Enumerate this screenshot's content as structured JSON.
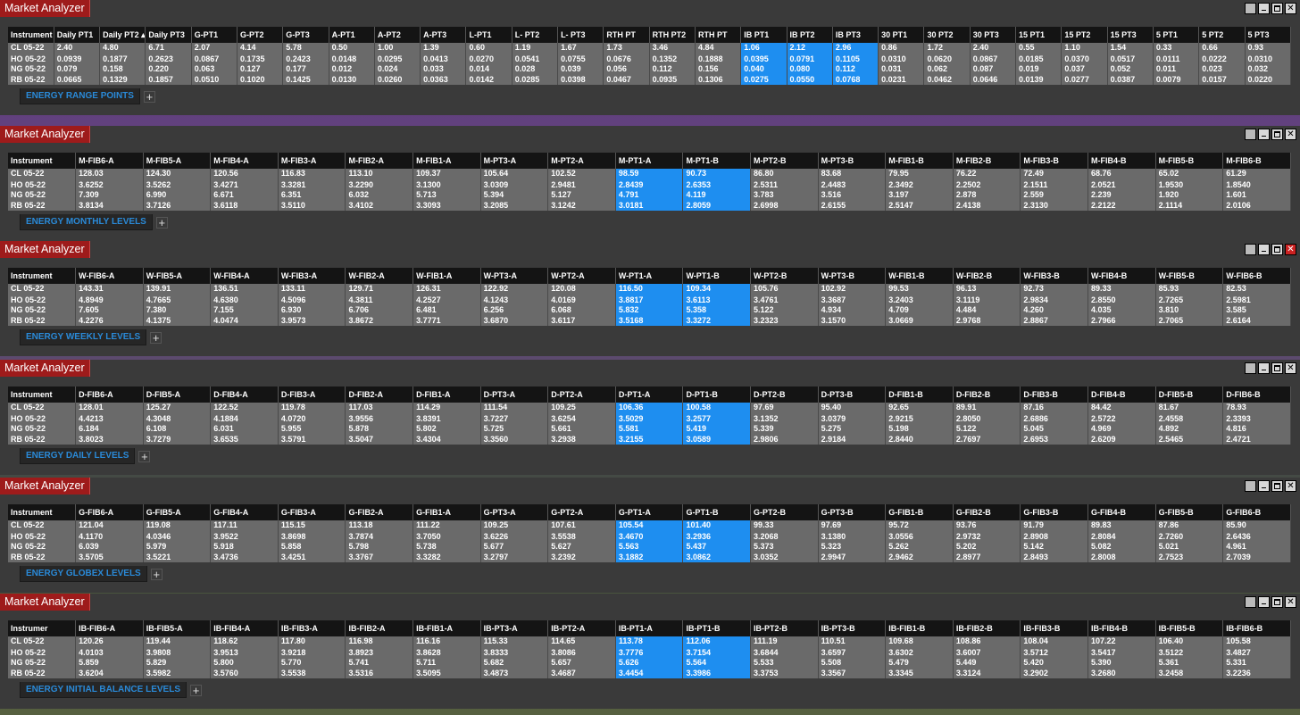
{
  "window_title": "Market Analyzer",
  "instruments": [
    "CL 05-22",
    "HO 05-22",
    "NG 05-22",
    "RB 05-22"
  ],
  "panels": [
    {
      "tab_label": "ENERGY RANGE POINTS",
      "columns": [
        "Instrument",
        "Daily PT1",
        "Daily PT2 ▴",
        "Daily PT3",
        "G-PT1",
        "G-PT2",
        "G-PT3",
        "A-PT1",
        "A-PT2",
        "A-PT3",
        "L-PT1",
        "L- PT2",
        "L- PT3",
        "RTH PT",
        "RTH PT2",
        "RTH PT",
        "IB PT1",
        "IB PT2",
        "IB PT3",
        "30 PT1",
        "30 PT2",
        "30 PT3",
        "15 PT1",
        "15 PT2",
        "15 PT3",
        "5 PT1",
        "5 PT2",
        "5 PT3"
      ],
      "highlight": [
        16,
        17,
        18
      ],
      "rows": [
        [
          "CL 05-22",
          "2.40",
          "4.80",
          "6.71",
          "2.07",
          "4.14",
          "5.78",
          "0.50",
          "1.00",
          "1.39",
          "0.60",
          "1.19",
          "1.67",
          "1.73",
          "3.46",
          "4.84",
          "1.06",
          "2.12",
          "2.96",
          "0.86",
          "1.72",
          "2.40",
          "0.55",
          "1.10",
          "1.54",
          "0.33",
          "0.66",
          "0.93"
        ],
        [
          "HO 05-22",
          "0.0939",
          "0.1877",
          "0.2623",
          "0.0867",
          "0.1735",
          "0.2423",
          "0.0148",
          "0.0295",
          "0.0413",
          "0.0270",
          "0.0541",
          "0.0755",
          "0.0676",
          "0.1352",
          "0.1888",
          "0.0395",
          "0.0791",
          "0.1105",
          "0.0310",
          "0.0620",
          "0.0867",
          "0.0185",
          "0.0370",
          "0.0517",
          "0.0111",
          "0.0222",
          "0.0310"
        ],
        [
          "NG 05-22",
          "0.079",
          "0.158",
          "0.220",
          "0.063",
          "0.127",
          "0.177",
          "0.012",
          "0.024",
          "0.033",
          "0.014",
          "0.028",
          "0.039",
          "0.056",
          "0.112",
          "0.156",
          "0.040",
          "0.080",
          "0.112",
          "0.031",
          "0.062",
          "0.087",
          "0.019",
          "0.037",
          "0.052",
          "0.011",
          "0.023",
          "0.032"
        ],
        [
          "RB 05-22",
          "0.0665",
          "0.1329",
          "0.1857",
          "0.0510",
          "0.1020",
          "0.1425",
          "0.0130",
          "0.0260",
          "0.0363",
          "0.0142",
          "0.0285",
          "0.0398",
          "0.0467",
          "0.0935",
          "0.1306",
          "0.0275",
          "0.0550",
          "0.0768",
          "0.0231",
          "0.0462",
          "0.0646",
          "0.0139",
          "0.0277",
          "0.0387",
          "0.0079",
          "0.0157",
          "0.0220"
        ]
      ]
    },
    {
      "tab_label": "ENERGY MONTHLY LEVELS",
      "columns": [
        "Instrument",
        "M-FIB6-A",
        "M-FIB5-A",
        "M-FIB4-A",
        "M-FIB3-A",
        "M-FIB2-A",
        "M-FIB1-A",
        "M-PT3-A",
        "M-PT2-A",
        "M-PT1-A",
        "M-PT1-B",
        "M-PT2-B",
        "M-PT3-B",
        "M-FIB1-B",
        "M-FIB2-B",
        "M-FIB3-B",
        "M-FIB4-B",
        "M-FIB5-B",
        "M-FIB6-B"
      ],
      "highlight": [
        9,
        10
      ],
      "rows": [
        [
          "CL 05-22",
          "128.03",
          "124.30",
          "120.56",
          "116.83",
          "113.10",
          "109.37",
          "105.64",
          "102.52",
          "98.59",
          "90.73",
          "86.80",
          "83.68",
          "79.95",
          "76.22",
          "72.49",
          "68.76",
          "65.02",
          "61.29"
        ],
        [
          "HO 05-22",
          "3.6252",
          "3.5262",
          "3.4271",
          "3.3281",
          "3.2290",
          "3.1300",
          "3.0309",
          "2.9481",
          "2.8439",
          "2.6353",
          "2.5311",
          "2.4483",
          "2.3492",
          "2.2502",
          "2.1511",
          "2.0521",
          "1.9530",
          "1.8540"
        ],
        [
          "NG 05-22",
          "7.309",
          "6.990",
          "6.671",
          "6.351",
          "6.032",
          "5.713",
          "5.394",
          "5.127",
          "4.791",
          "4.119",
          "3.783",
          "3.516",
          "3.197",
          "2.878",
          "2.559",
          "2.239",
          "1.920",
          "1.601"
        ],
        [
          "RB 05-22",
          "3.8134",
          "3.7126",
          "3.6118",
          "3.5110",
          "3.4102",
          "3.3093",
          "3.2085",
          "3.1242",
          "3.0181",
          "2.8059",
          "2.6998",
          "2.6155",
          "2.5147",
          "2.4138",
          "2.3130",
          "2.2122",
          "2.1114",
          "2.0106"
        ]
      ]
    },
    {
      "tab_label": "ENERGY WEEKLY LEVELS",
      "columns": [
        "Instrument",
        "W-FIB6-A",
        "W-FIB5-A",
        "W-FIB4-A",
        "W-FIB3-A",
        "W-FIB2-A",
        "W-FIB1-A",
        "W-PT3-A",
        "W-PT2-A",
        "W-PT1-A",
        "W-PT1-B",
        "W-PT2-B",
        "W-PT3-B",
        "W-FIB1-B",
        "W-FIB2-B",
        "W-FIB3-B",
        "W-FIB4-B",
        "W-FIB5-B",
        "W-FIB6-B"
      ],
      "highlight": [
        9,
        10
      ],
      "rows": [
        [
          "CL 05-22",
          "143.31",
          "139.91",
          "136.51",
          "133.11",
          "129.71",
          "126.31",
          "122.92",
          "120.08",
          "116.50",
          "109.34",
          "105.76",
          "102.92",
          "99.53",
          "96.13",
          "92.73",
          "89.33",
          "85.93",
          "82.53"
        ],
        [
          "HO 05-22",
          "4.8949",
          "4.7665",
          "4.6380",
          "4.5096",
          "4.3811",
          "4.2527",
          "4.1243",
          "4.0169",
          "3.8817",
          "3.6113",
          "3.4761",
          "3.3687",
          "3.2403",
          "3.1119",
          "2.9834",
          "2.8550",
          "2.7265",
          "2.5981"
        ],
        [
          "NG 05-22",
          "7.605",
          "7.380",
          "7.155",
          "6.930",
          "6.706",
          "6.481",
          "6.256",
          "6.068",
          "5.832",
          "5.358",
          "5.122",
          "4.934",
          "4.709",
          "4.484",
          "4.260",
          "4.035",
          "3.810",
          "3.585"
        ],
        [
          "RB 05-22",
          "4.2276",
          "4.1375",
          "4.0474",
          "3.9573",
          "3.8672",
          "3.7771",
          "3.6870",
          "3.6117",
          "3.5168",
          "3.3272",
          "3.2323",
          "3.1570",
          "3.0669",
          "2.9768",
          "2.8867",
          "2.7966",
          "2.7065",
          "2.6164"
        ]
      ]
    },
    {
      "tab_label": "ENERGY DAILY LEVELS",
      "columns": [
        "Instrument",
        "D-FIB6-A",
        "D-FIB5-A",
        "D-FIB4-A",
        "D-FIB3-A",
        "D-FIB2-A",
        "D-FIB1-A",
        "D-PT3-A",
        "D-PT2-A",
        "D-PT1-A",
        "D-PT1-B",
        "D-PT2-B",
        "D-PT3-B",
        "D-FIB1-B",
        "D-FIB2-B",
        "D-FIB3-B",
        "D-FIB4-B",
        "D-FIB5-B",
        "D-FIB6-B"
      ],
      "highlight": [
        9,
        10
      ],
      "rows": [
        [
          "CL 05-22",
          "128.01",
          "125.27",
          "122.52",
          "119.78",
          "117.03",
          "114.29",
          "111.54",
          "109.25",
          "106.36",
          "100.58",
          "97.69",
          "95.40",
          "92.65",
          "89.91",
          "87.16",
          "84.42",
          "81.67",
          "78.93"
        ],
        [
          "HO 05-22",
          "4.4213",
          "4.3048",
          "4.1884",
          "4.0720",
          "3.9556",
          "3.8391",
          "3.7227",
          "3.6254",
          "3.5029",
          "3.2577",
          "3.1352",
          "3.0379",
          "2.9215",
          "2.8050",
          "2.6886",
          "2.5722",
          "2.4558",
          "2.3393"
        ],
        [
          "NG 05-22",
          "6.184",
          "6.108",
          "6.031",
          "5.955",
          "5.878",
          "5.802",
          "5.725",
          "5.661",
          "5.581",
          "5.419",
          "5.339",
          "5.275",
          "5.198",
          "5.122",
          "5.045",
          "4.969",
          "4.892",
          "4.816"
        ],
        [
          "RB 05-22",
          "3.8023",
          "3.7279",
          "3.6535",
          "3.5791",
          "3.5047",
          "3.4304",
          "3.3560",
          "3.2938",
          "3.2155",
          "3.0589",
          "2.9806",
          "2.9184",
          "2.8440",
          "2.7697",
          "2.6953",
          "2.6209",
          "2.5465",
          "2.4721"
        ]
      ]
    },
    {
      "tab_label": "ENERGY GLOBEX LEVELS",
      "columns": [
        "Instrument",
        "G-FIB6-A",
        "G-FIB5-A",
        "G-FIB4-A",
        "G-FIB3-A",
        "G-FIB2-A",
        "G-FIB1-A",
        "G-PT3-A",
        "G-PT2-A",
        "G-PT1-A",
        "G-PT1-B",
        "G-PT2-B",
        "G-PT3-B",
        "G-FIB1-B",
        "G-FIB2-B",
        "G-FIB3-B",
        "G-FIB4-B",
        "G-FIB5-B",
        "G-FIB6-B"
      ],
      "highlight": [
        9,
        10
      ],
      "rows": [
        [
          "CL 05-22",
          "121.04",
          "119.08",
          "117.11",
          "115.15",
          "113.18",
          "111.22",
          "109.25",
          "107.61",
          "105.54",
          "101.40",
          "99.33",
          "97.69",
          "95.72",
          "93.76",
          "91.79",
          "89.83",
          "87.86",
          "85.90"
        ],
        [
          "HO 05-22",
          "4.1170",
          "4.0346",
          "3.9522",
          "3.8698",
          "3.7874",
          "3.7050",
          "3.6226",
          "3.5538",
          "3.4670",
          "3.2936",
          "3.2068",
          "3.1380",
          "3.0556",
          "2.9732",
          "2.8908",
          "2.8084",
          "2.7260",
          "2.6436"
        ],
        [
          "NG 05-22",
          "6.039",
          "5.979",
          "5.918",
          "5.858",
          "5.798",
          "5.738",
          "5.677",
          "5.627",
          "5.563",
          "5.437",
          "5.373",
          "5.323",
          "5.262",
          "5.202",
          "5.142",
          "5.082",
          "5.021",
          "4.961"
        ],
        [
          "RB 05-22",
          "3.5705",
          "3.5221",
          "3.4736",
          "3.4251",
          "3.3767",
          "3.3282",
          "3.2797",
          "3.2392",
          "3.1882",
          "3.0862",
          "3.0352",
          "2.9947",
          "2.9462",
          "2.8977",
          "2.8493",
          "2.8008",
          "2.7523",
          "2.7039"
        ]
      ]
    },
    {
      "tab_label": "ENERGY INITIAL BALANCE LEVELS",
      "columns": [
        "Instrumer",
        "IB-FIB6-A",
        "IB-FIB5-A",
        "IB-FIB4-A",
        "IB-FIB3-A",
        "IB-FIB2-A",
        "IB-FIB1-A",
        "IB-PT3-A",
        "IB-PT2-A",
        "IB-PT1-A",
        "IB-PT1-B",
        "IB-PT2-B",
        "IB-PT3-B",
        "IB-FIB1-B",
        "IB-FIB2-B",
        "IB-FIB3-B",
        "IB-FIB4-B",
        "IB-FIB5-B",
        "IB-FIB6-B"
      ],
      "highlight": [
        9,
        10
      ],
      "rows": [
        [
          "CL 05-22",
          "120.26",
          "119.44",
          "118.62",
          "117.80",
          "116.98",
          "116.16",
          "115.33",
          "114.65",
          "113.78",
          "112.06",
          "111.19",
          "110.51",
          "109.68",
          "108.86",
          "108.04",
          "107.22",
          "106.40",
          "105.58"
        ],
        [
          "HO 05-22",
          "4.0103",
          "3.9808",
          "3.9513",
          "3.9218",
          "3.8923",
          "3.8628",
          "3.8333",
          "3.8086",
          "3.7776",
          "3.7154",
          "3.6844",
          "3.6597",
          "3.6302",
          "3.6007",
          "3.5712",
          "3.5417",
          "3.5122",
          "3.4827"
        ],
        [
          "NG 05-22",
          "5.859",
          "5.829",
          "5.800",
          "5.770",
          "5.741",
          "5.711",
          "5.682",
          "5.657",
          "5.626",
          "5.564",
          "5.533",
          "5.508",
          "5.479",
          "5.449",
          "5.420",
          "5.390",
          "5.361",
          "5.331"
        ],
        [
          "RB 05-22",
          "3.6204",
          "3.5982",
          "3.5760",
          "3.5538",
          "3.5316",
          "3.5095",
          "3.4873",
          "3.4687",
          "3.4454",
          "3.3986",
          "3.3753",
          "3.3567",
          "3.3345",
          "3.3124",
          "3.2902",
          "3.2680",
          "3.2458",
          "3.2236"
        ]
      ]
    }
  ],
  "colors": {
    "title_bg": "#9e1b1b",
    "highlight": "#1e8ef0",
    "tab_text": "#2a8ad8",
    "header_bg": "#141414",
    "cell_bg": "#6a6a6a"
  },
  "icons": {
    "minimize": "minimize-icon",
    "maximize": "maximize-icon",
    "close": "close-icon",
    "add_tab": "plus-icon"
  }
}
